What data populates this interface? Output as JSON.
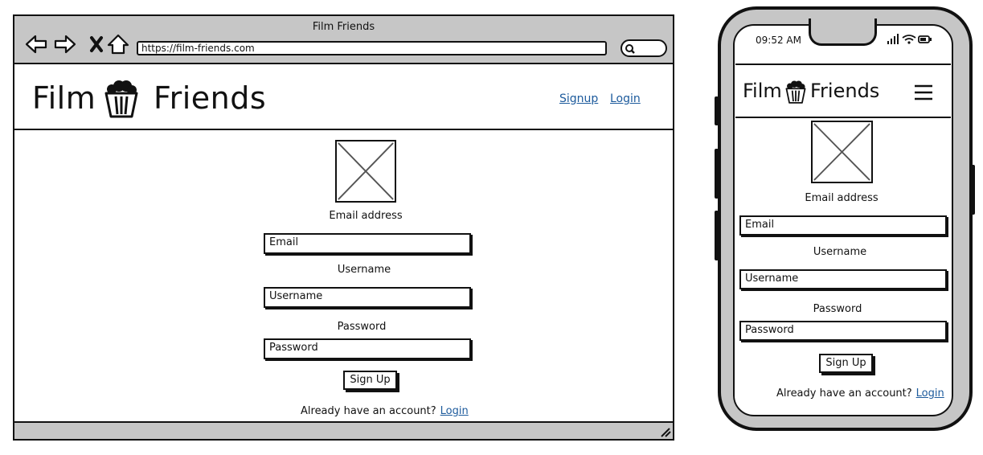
{
  "desktop": {
    "window_title": "Film Friends",
    "url": "https://film-friends.com",
    "brand_left": "Film",
    "brand_right": "Friends",
    "nav": {
      "signup": "Signup",
      "login": "Login"
    },
    "form": {
      "email_label": "Email address",
      "email_placeholder": "Email",
      "username_label": "Username",
      "username_placeholder": "Username",
      "password_label": "Password",
      "password_placeholder": "Password",
      "submit": "Sign Up",
      "account_text": "Already have an account?",
      "account_link": "Login"
    }
  },
  "mobile": {
    "status_time": "09:52 AM",
    "brand_left": "Film",
    "brand_right": "Friends",
    "form": {
      "email_label": "Email address",
      "email_placeholder": "Email",
      "username_label": "Username",
      "username_placeholder": "Username",
      "password_label": "Password",
      "password_placeholder": "Password",
      "submit": "Sign Up",
      "account_text": "Already have an account?",
      "account_link": "Login"
    }
  },
  "colors": {
    "chrome": "#c6c6c6",
    "link": "#1c5a9c",
    "ink": "#111111"
  },
  "icons": [
    "back-arrow-icon",
    "forward-arrow-icon",
    "close-icon",
    "home-icon",
    "search-icon",
    "popcorn-icon",
    "image-placeholder-icon",
    "resize-grip-icon",
    "signal-icon",
    "wifi-icon",
    "battery-icon",
    "hamburger-menu-icon"
  ]
}
